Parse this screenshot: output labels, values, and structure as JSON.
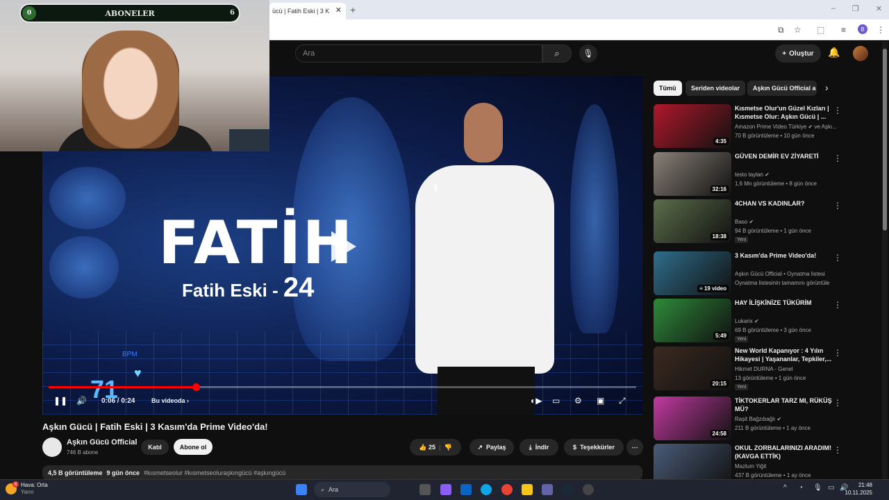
{
  "browser": {
    "tab_title": "ücü | Fatih Eski | 3 K",
    "tab_close": "✕",
    "new_tab": "+",
    "win_min": "–",
    "win_max": "❐",
    "win_close": "✕",
    "profile_initial": "B"
  },
  "overlay": {
    "subs_label": "ABONELER",
    "subs_left": "0",
    "subs_count": "6"
  },
  "header": {
    "search_placeholder": "Ara",
    "create_label": "Oluştur"
  },
  "video": {
    "overlay_title": "FATİH",
    "overlay_sub": "Fatih Eski - ",
    "overlay_num": "24",
    "hud_number": "71",
    "hud_bpm": "BPM",
    "time": "0:06 / 0:24",
    "chapter": "Bu videoda",
    "progress": 0.25
  },
  "meta": {
    "title": "Aşkın Gücü | Fatih Eski | 3 Kasım'da Prime Video'da!",
    "channel": "Aşkın Gücü Official",
    "channel_subs": "746 B abone",
    "join": "Katıl",
    "subscribe": "Abone ol",
    "likes": "25",
    "share": "Paylaş",
    "download": "İndir",
    "thanks": "Teşekkürler",
    "views": "4,5 B görüntüleme",
    "age": "9 gün önce",
    "tags": "#kısmetseolur #kısmetseoluraşkıngücü #aşkıngücü"
  },
  "chips": [
    "Tümü",
    "Seriden videolar",
    "Aşkın Gücü Official a"
  ],
  "recommendations": [
    {
      "title": "Kısmetse Olur'un Güzel Kızları | Kısmetse Olur: Aşkın Gücü | ...",
      "channel": "Amazon Prime Video Türkiye ✔ ve Aşkı...",
      "meta": "70 B görüntüleme • 10 gün önce",
      "duration": "4:35",
      "badge": "",
      "color": "#b0182a"
    },
    {
      "title": "GÜVEN DEMİR EV ZİYARETİ",
      "channel": "testo taylan ✔",
      "meta": "1,6 Mn görüntüleme • 8 gün önce",
      "duration": "32:16",
      "badge": "",
      "color": "#8a8178"
    },
    {
      "title": "4CHAN VS KADINLAR?",
      "channel": "Baso ✔",
      "meta": "94 B görüntüleme • 1 gün önce",
      "duration": "18:38",
      "badge": "Yeni",
      "color": "#5b6e4a"
    },
    {
      "title": "3 Kasım'da Prime Video'da!",
      "channel": "Aşkın Gücü Official • Oynatma listesi",
      "meta": "Oynatma listesinin tamamını görüntüle",
      "duration": "≡ 19 video",
      "badge": "",
      "color": "#2f6e8c"
    },
    {
      "title": "HAY İLİŞKİNİZE TÜKÜRİM",
      "channel": "Lukarix ✔",
      "meta": "69 B görüntüleme • 3 gün önce",
      "duration": "5:49",
      "badge": "Yeni",
      "color": "#2e8a3a"
    },
    {
      "title": "New World Kapanıyor : 4 Yılın Hikayesi | Yaşananlar, Tepkiler,...",
      "channel": "Hikmet DURNA - Genel",
      "meta": "13 görüntüleme • 1 gün önce",
      "duration": "20:15",
      "badge": "Yeni",
      "color": "#3b2a20"
    },
    {
      "title": "TİKTOKERLAR TARZ MI, RÜKÜŞ MÜ?",
      "channel": "Raşit Bağzıbağlı ✔",
      "meta": "211 B görüntüleme • 1 ay önce",
      "duration": "24:58",
      "badge": "",
      "color": "#c23aa0"
    },
    {
      "title": "OKUL ZORBALARINIZI ARADIM! (KAVGA ETTİK)",
      "channel": "Mazlum Yiğit",
      "meta": "437 B görüntüleme • 1 ay önce",
      "duration": "",
      "badge": "",
      "color": "#4a5b78"
    }
  ],
  "taskbar": {
    "weather_title": "Hava: Orta",
    "weather_sub": "Yarın",
    "weather_badge": "6",
    "search": "Ara",
    "time": "21:48",
    "date": "10.11.2025"
  },
  "colors": {
    "accent": "#ff0000",
    "bg": "#0f0f0f"
  }
}
